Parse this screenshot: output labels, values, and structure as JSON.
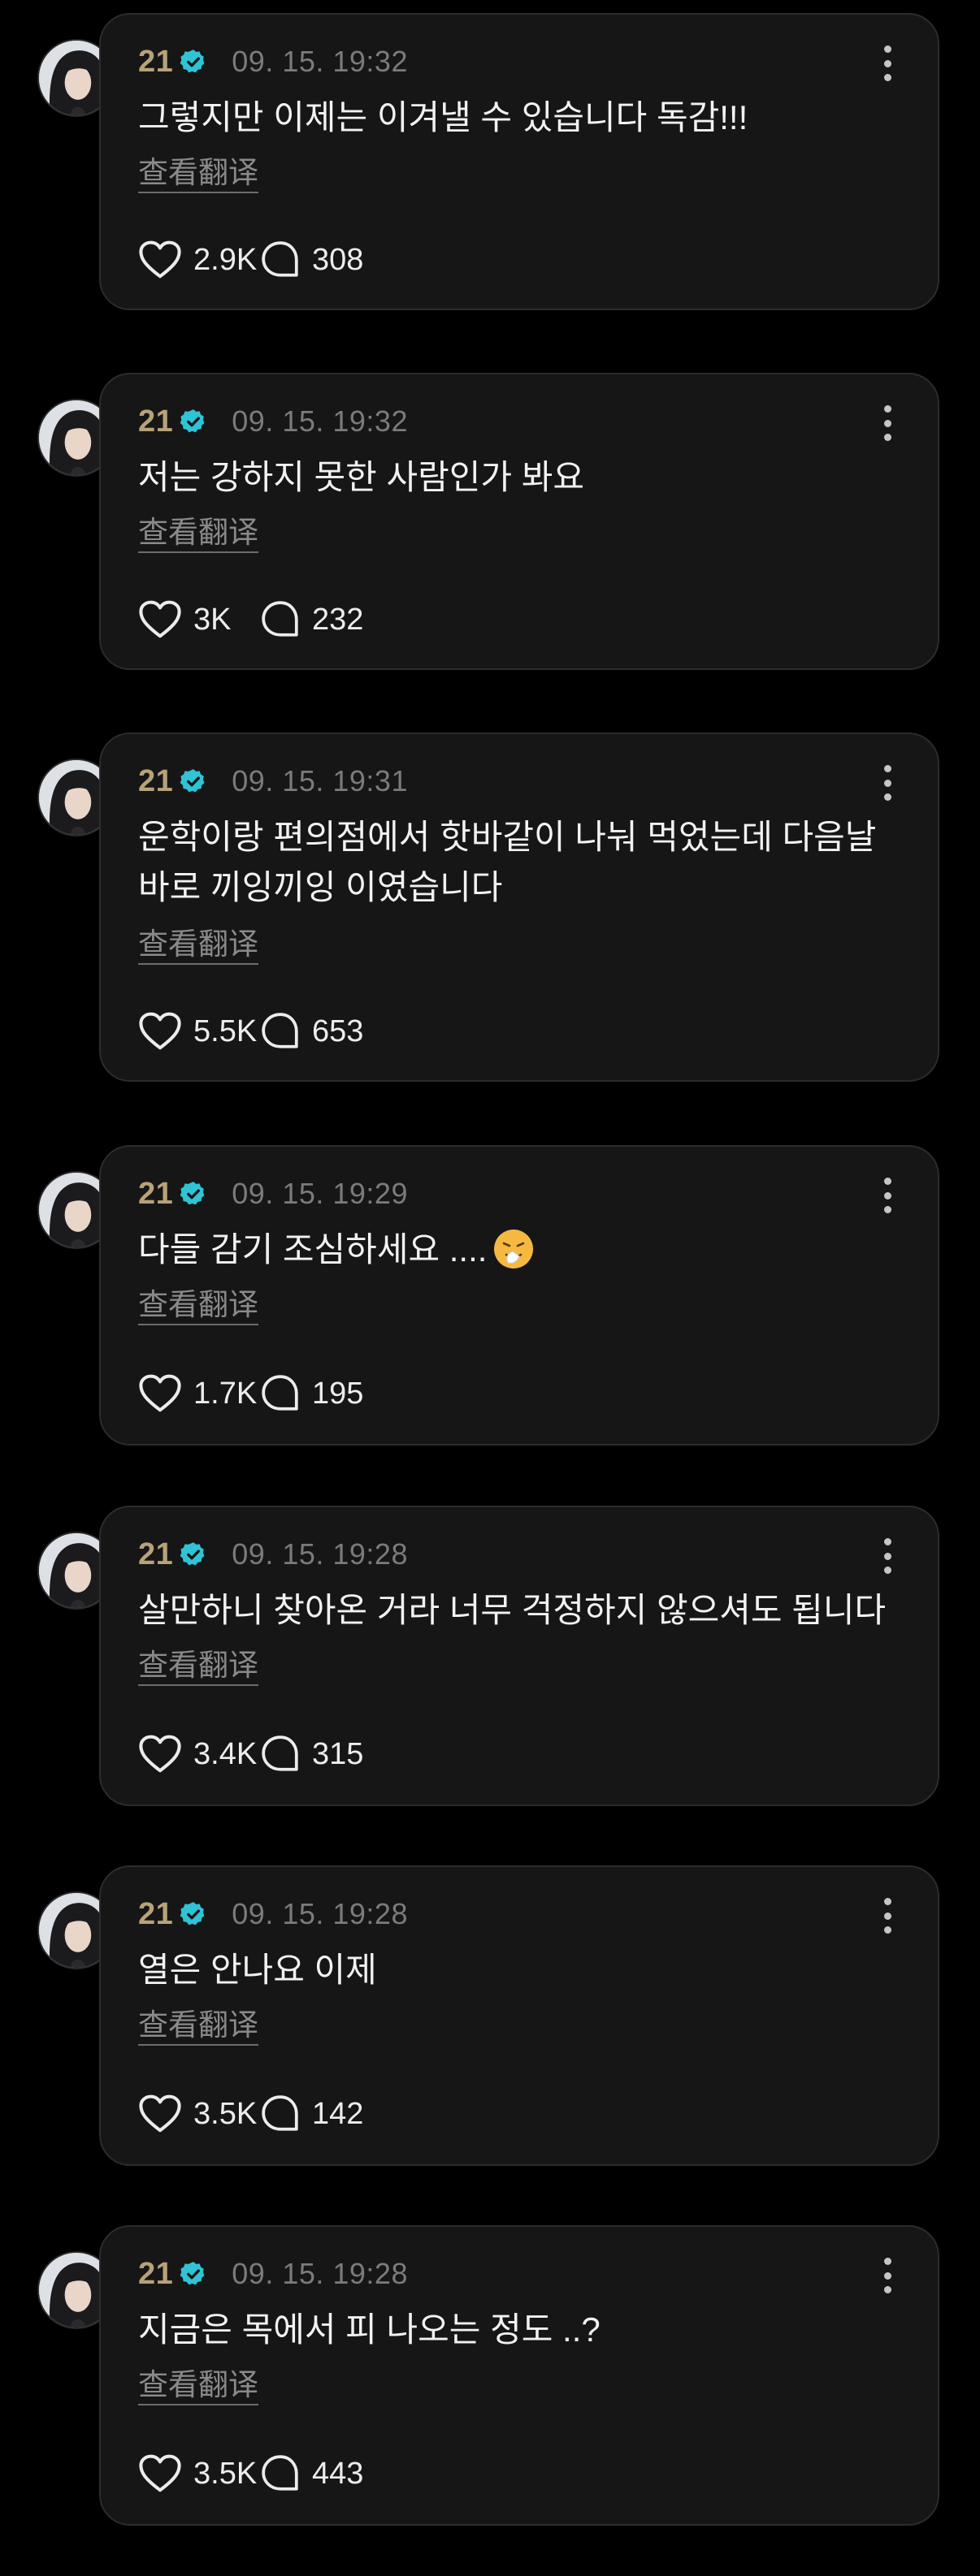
{
  "posts": [
    {
      "username": "21",
      "timestamp": "09. 15. 19:32",
      "text": "그렇지만 이제는 이겨낼 수 있습니다 독감!!!",
      "translate_label": "查看翻译",
      "likes": "2.9K",
      "comments": "308"
    },
    {
      "username": "21",
      "timestamp": "09. 15. 19:32",
      "text": "저는 강하지 못한 사람인가 봐요",
      "translate_label": "查看翻译",
      "likes": "3K",
      "comments": "232"
    },
    {
      "username": "21",
      "timestamp": "09. 15. 19:31",
      "text": "운학이랑 편의점에서 핫바같이 나눠 먹었는데 다음날 바로 끼잉끼잉 이였습니다",
      "translate_label": "查看翻译",
      "likes": "5.5K",
      "comments": "653"
    },
    {
      "username": "21",
      "timestamp": "09. 15. 19:29",
      "text": "다들 감기 조심하세요 ....",
      "emoji": "sneezing-face-emoji",
      "translate_label": "查看翻译",
      "likes": "1.7K",
      "comments": "195"
    },
    {
      "username": "21",
      "timestamp": "09. 15. 19:28",
      "text": "살만하니 찾아온 거라 너무 걱정하지 않으셔도 됩니다",
      "translate_label": "查看翻译",
      "likes": "3.4K",
      "comments": "315"
    },
    {
      "username": "21",
      "timestamp": "09. 15. 19:28",
      "text": "열은 안나요 이제",
      "translate_label": "查看翻译",
      "likes": "3.5K",
      "comments": "142"
    },
    {
      "username": "21",
      "timestamp": "09. 15. 19:28",
      "text": "지금은 목에서 피 나오는 정도 ..?",
      "translate_label": "查看翻译",
      "likes": "3.5K",
      "comments": "443"
    }
  ],
  "icons": {
    "verified": "verified-badge-icon",
    "more": "more-options-icon",
    "like": "heart-icon",
    "comment": "comment-bubble-icon"
  },
  "colors": {
    "background": "#000000",
    "card": "#161616",
    "username": "#b8a27a",
    "verified": "#2ec4d6",
    "timestamp": "#7b7b7b",
    "text": "#f2f2f2"
  }
}
